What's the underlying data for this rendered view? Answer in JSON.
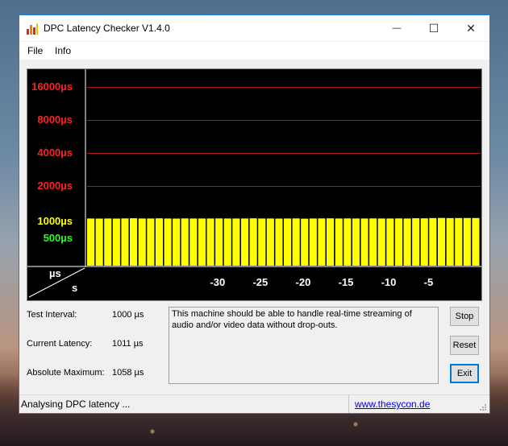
{
  "window": {
    "title": "DPC Latency Checker V1.4.0",
    "controls": {
      "minimize": "—",
      "maximize": "☐",
      "close": "✕"
    }
  },
  "menu": {
    "items": [
      "File",
      "Info"
    ]
  },
  "graph": {
    "y_labels": [
      {
        "text": "16000µs",
        "color": "#ff2020"
      },
      {
        "text": "8000µs",
        "color": "#ff2020"
      },
      {
        "text": "4000µs",
        "color": "#ff2020"
      },
      {
        "text": "2000µs",
        "color": "#ff2020"
      },
      {
        "text": "1000µs",
        "color": "#ffff00"
      },
      {
        "text": "500µs",
        "color": "#20ff20"
      }
    ],
    "unit_top": "µs",
    "unit_bottom": "s",
    "x_labels": [
      "-30",
      "-25",
      "-20",
      "-15",
      "-10",
      "-5"
    ],
    "bar_color": "#ffff00",
    "grid_color": "#b01818",
    "bar_values_us": [
      1011,
      1008,
      1010,
      1009,
      1012,
      1015,
      1011,
      1010,
      1013,
      1011,
      1009,
      1012,
      1010,
      1011,
      1010,
      1012,
      1011,
      1010,
      1011,
      1013,
      1011,
      1010,
      1009,
      1011,
      1012,
      1006,
      1011,
      1012,
      1013,
      1011,
      1012,
      1010,
      1011,
      1012,
      1011,
      1010,
      1012,
      1011,
      1015,
      1013,
      1018,
      1022,
      1019,
      1020,
      1020,
      1021
    ]
  },
  "stats": {
    "test_interval": {
      "label": "Test Interval:",
      "value": "1000 µs"
    },
    "current_latency": {
      "label": "Current Latency:",
      "value": "1011 µs"
    },
    "absolute_maximum": {
      "label": "Absolute Maximum:",
      "value": "1058 µs"
    }
  },
  "message": "This machine should be able to handle real-time streaming of audio and/or video data without drop-outs.",
  "buttons": {
    "stop": "Stop",
    "reset": "Reset",
    "exit": "Exit"
  },
  "status": {
    "text": "Analysing DPC latency ...",
    "link": "www.thesycon.de"
  }
}
